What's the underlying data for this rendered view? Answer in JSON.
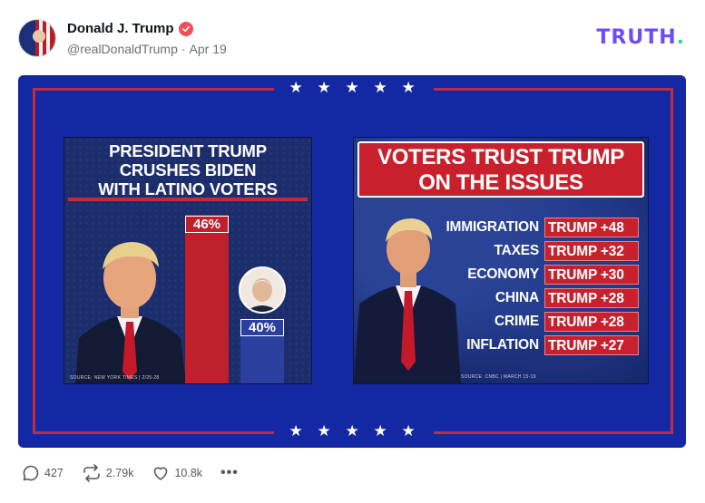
{
  "post": {
    "author_name": "Donald J. Trump",
    "handle": "@realDonaldTrump",
    "separator": "·",
    "date": "Apr 19",
    "brand": "TRUTH",
    "brand_dot": "."
  },
  "image": {
    "stars_top": [
      "★",
      "★",
      "★",
      "★",
      "★"
    ],
    "stars_bottom": [
      "★",
      "★",
      "★",
      "★",
      "★"
    ],
    "left_graphic": {
      "title_lines": [
        "PRESIDENT TRUMP",
        "CRUSHES BIDEN",
        "WITH LATINO VOTERS"
      ],
      "trump_pct_label": "46%",
      "biden_pct_label": "40%",
      "trump_value": 46,
      "biden_value": 40,
      "source": "SOURCE: NEW YORK TIMES | 2/25-28"
    },
    "right_graphic": {
      "title_lines": [
        "VOTERS TRUST TRUMP",
        "ON THE ISSUES"
      ],
      "issues": [
        {
          "name": "IMMIGRATION",
          "value": "TRUMP +48"
        },
        {
          "name": "TAXES",
          "value": "TRUMP +32"
        },
        {
          "name": "ECONOMY",
          "value": "TRUMP +30"
        },
        {
          "name": "CHINA",
          "value": "TRUMP +28"
        },
        {
          "name": "CRIME",
          "value": "TRUMP +28"
        },
        {
          "name": "INFLATION",
          "value": "TRUMP +27"
        }
      ],
      "source": "SOURCE: CNBC | MARCH 15-19"
    }
  },
  "actions": {
    "replies": "427",
    "retruths": "2.79k",
    "likes": "10.8k",
    "more": "•••"
  },
  "colors": {
    "brand_purple": "#6d4cf7",
    "brand_teal": "#2ed1a3",
    "navy": "#1528a4",
    "red": "#c8212d",
    "verified": "#ee4f5a"
  }
}
